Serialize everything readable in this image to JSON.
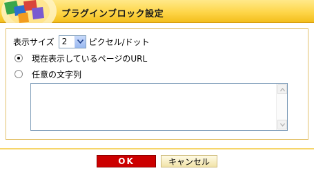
{
  "header": {
    "title": "プラグインブロック設定"
  },
  "size_row": {
    "label": "表示サイズ",
    "selected_value": "2",
    "unit": "ピクセル/ドット"
  },
  "options": [
    {
      "label": "現在表示しているページのURL",
      "checked": true
    },
    {
      "label": "任意の文字列",
      "checked": false
    }
  ],
  "textarea": {
    "value": ""
  },
  "buttons": {
    "ok_label": "OK",
    "cancel_label": "キャンセル"
  },
  "colors": {
    "header": "#fed64a",
    "ok": "#cc0000",
    "panel_border": "#e2c067"
  }
}
